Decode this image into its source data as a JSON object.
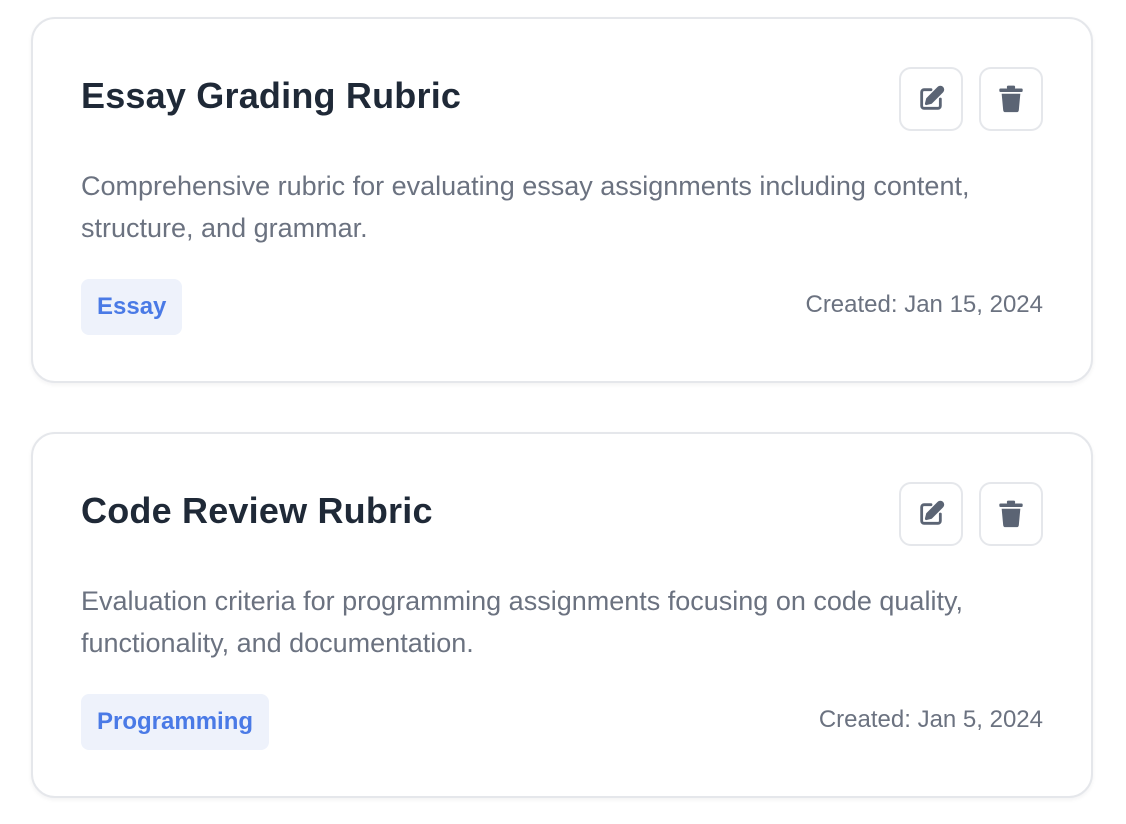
{
  "rubrics": [
    {
      "title": "Essay Grading Rubric",
      "description": "Comprehensive rubric for evaluating essay assignments including content, structure, and grammar.",
      "tag": "Essay",
      "created": "Created: Jan 15, 2024",
      "edit_icon": "edit-icon",
      "delete_icon": "trash-icon"
    },
    {
      "title": "Code Review Rubric",
      "description": "Evaluation criteria for programming assignments focusing on code quality, functionality, and documentation.",
      "tag": "Programming",
      "created": "Created: Jan 5, 2024",
      "edit_icon": "edit-icon",
      "delete_icon": "trash-icon"
    }
  ],
  "colors": {
    "title": "#1f2937",
    "text_muted": "#6b7280",
    "icon": "#5b6474",
    "tag_bg": "#eef2fb",
    "tag_text": "#4a7ae6",
    "border": "#e5e7eb"
  }
}
